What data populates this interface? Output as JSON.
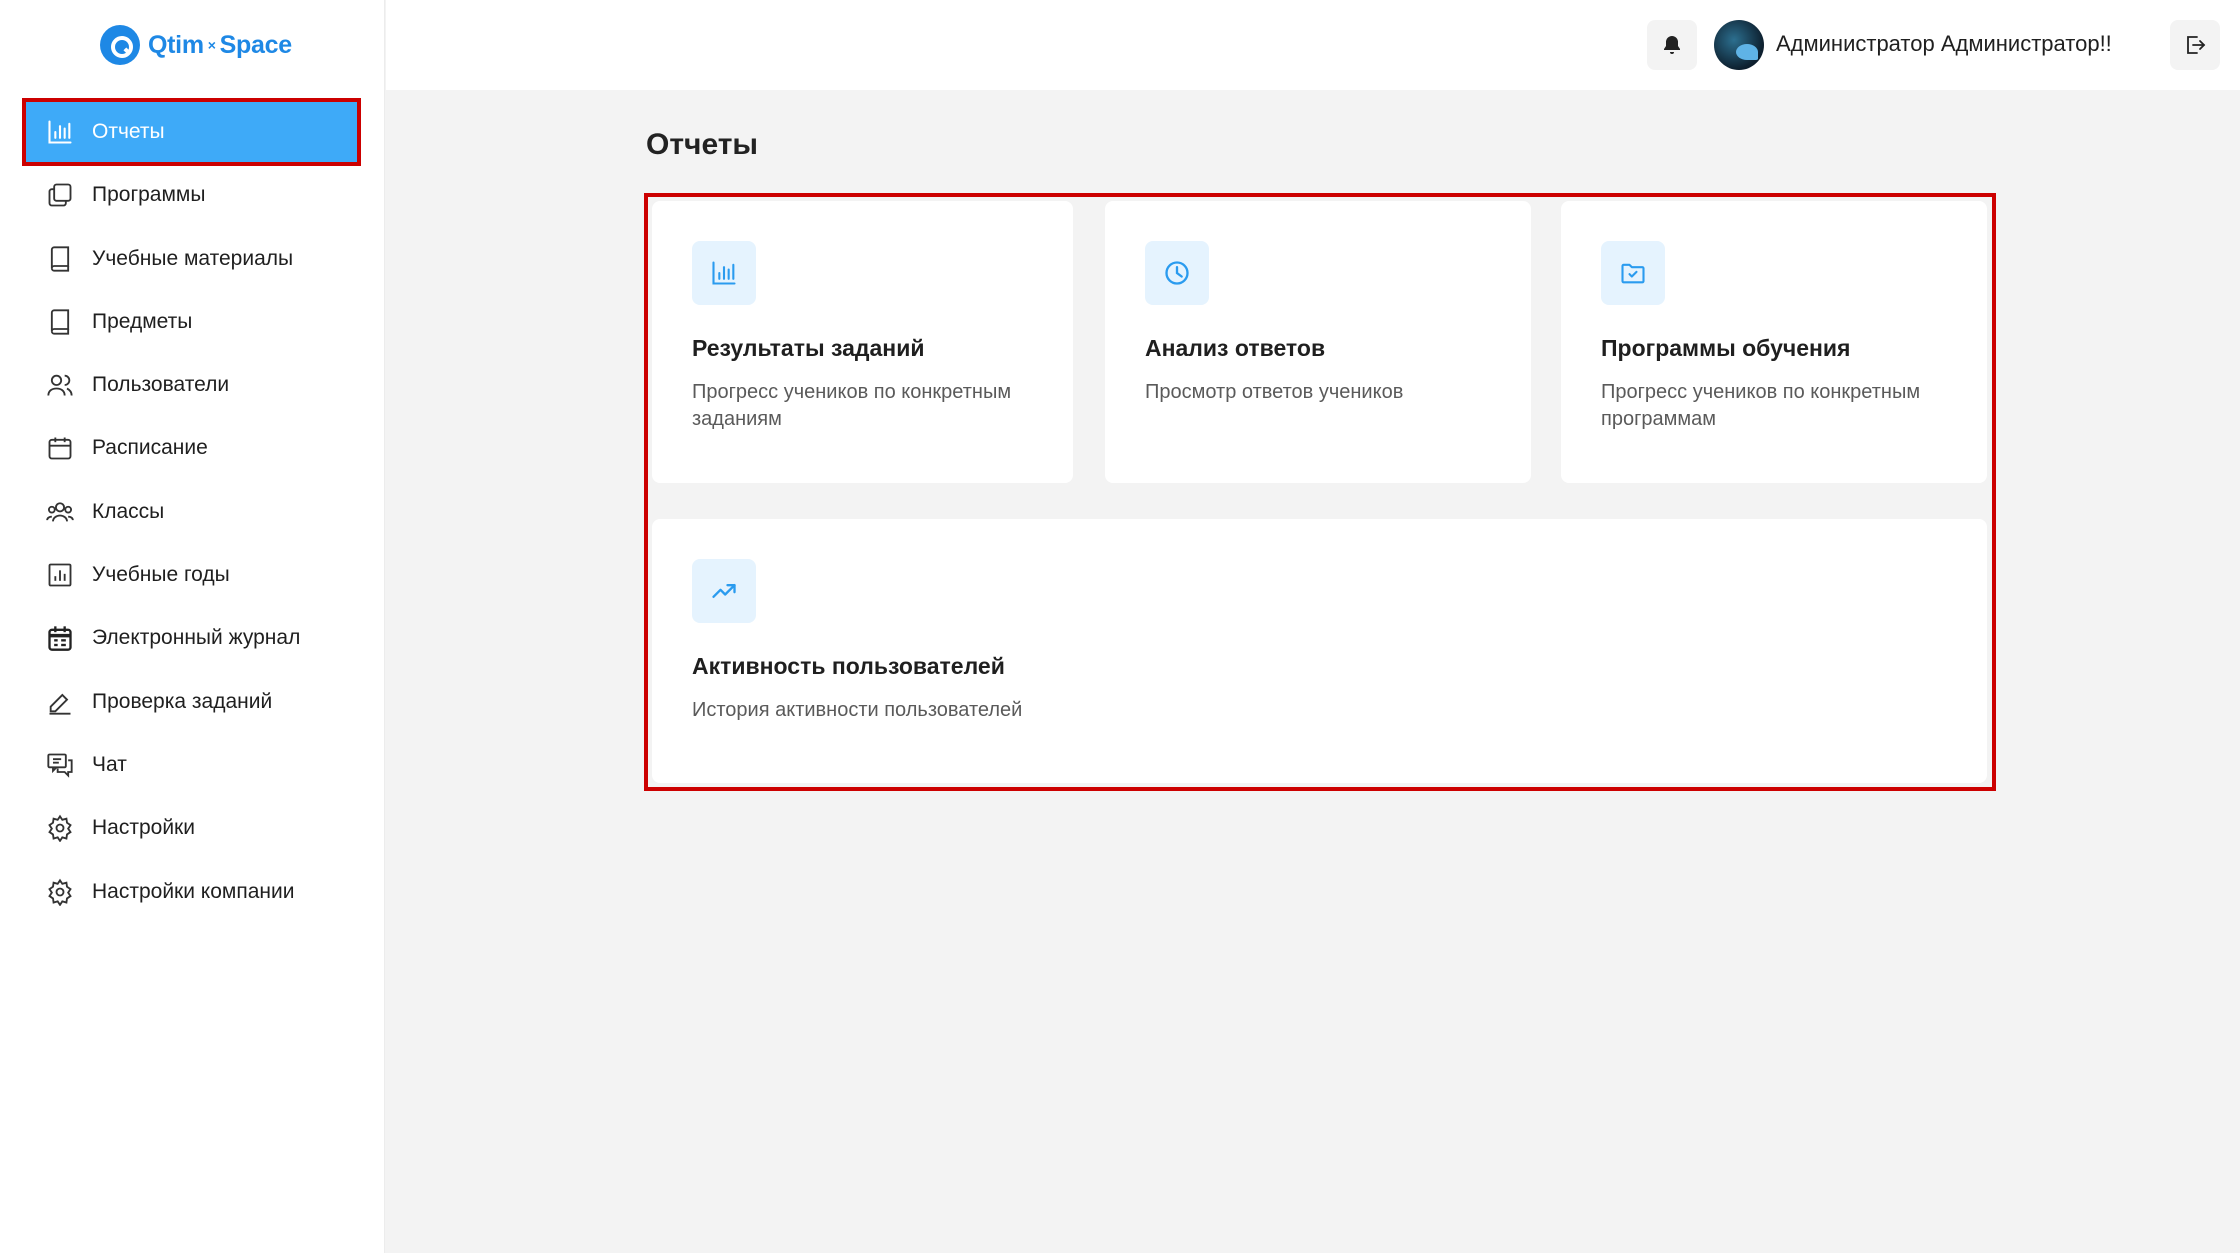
{
  "logo": {
    "brand_left": "Qtim",
    "brand_sep": "×",
    "brand_right": "Space"
  },
  "sidebar": {
    "items": [
      {
        "label": "Отчеты",
        "icon": "bar-chart-icon",
        "active": true
      },
      {
        "label": "Программы",
        "icon": "copy-icon"
      },
      {
        "label": "Учебные материалы",
        "icon": "book-icon"
      },
      {
        "label": "Предметы",
        "icon": "book-icon"
      },
      {
        "label": "Пользователи",
        "icon": "users-icon"
      },
      {
        "label": "Расписание",
        "icon": "calendar-icon"
      },
      {
        "label": "Классы",
        "icon": "group-icon"
      },
      {
        "label": "Учебные годы",
        "icon": "stats-icon"
      },
      {
        "label": "Электронный журнал",
        "icon": "journal-icon"
      },
      {
        "label": "Проверка заданий",
        "icon": "pencil-icon"
      },
      {
        "label": "Чат",
        "icon": "chat-icon"
      },
      {
        "label": "Настройки",
        "icon": "gear-icon"
      },
      {
        "label": "Настройки компании",
        "icon": "gear-icon"
      }
    ]
  },
  "header": {
    "user_name": "Администратор Администратор!!"
  },
  "main": {
    "title": "Отчеты",
    "cards": [
      {
        "title": "Результаты заданий",
        "desc": "Прогресс учеников по конкретным заданиям",
        "icon": "bar-chart-icon"
      },
      {
        "title": "Анализ ответов",
        "desc": "Просмотр ответов учеников",
        "icon": "pie-clock-icon"
      },
      {
        "title": "Программы обучения",
        "desc": "Прогресс учеников по конкретным программам",
        "icon": "folder-check-icon"
      },
      {
        "title": "Активность пользователей",
        "desc": "История активности пользователей",
        "icon": "trend-up-icon"
      }
    ]
  },
  "colors": {
    "accent": "#3eaaf8",
    "brand": "#1e88e5",
    "highlight": "#cc0000",
    "icon_bg": "#e5f3fe"
  }
}
